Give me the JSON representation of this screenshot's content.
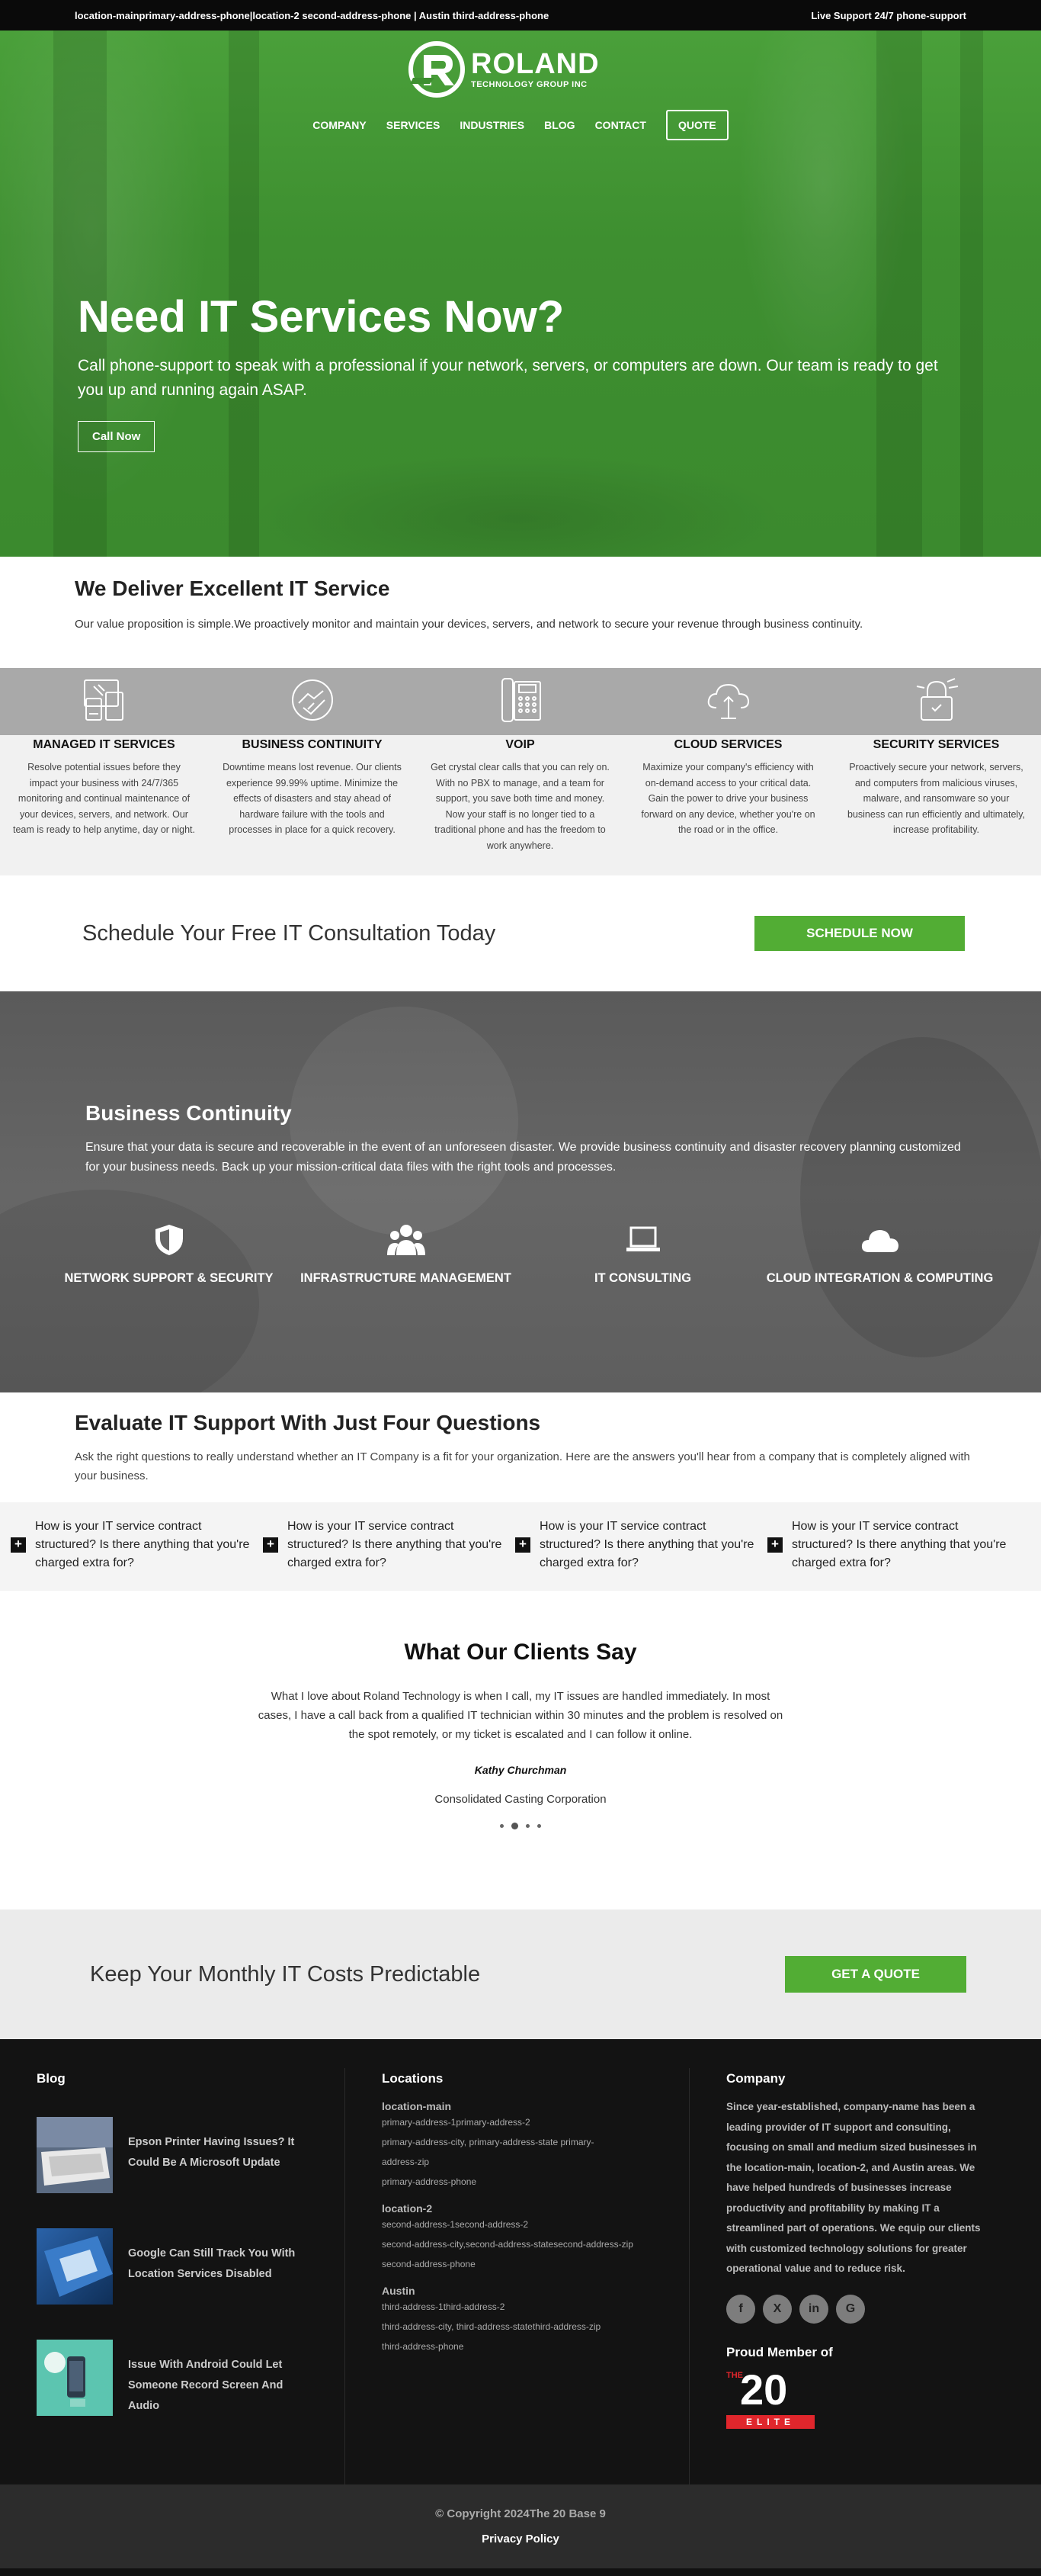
{
  "topbar": {
    "left": "location-mainprimary-address-phone|location-2 second-address-phone | Austin third-address-phone",
    "right": "Live Support 24/7 phone-support"
  },
  "logo": {
    "name": "ROLAND",
    "tagline": "TECHNOLOGY GROUP INC"
  },
  "nav": {
    "items": [
      "COMPANY",
      "SERVICES",
      "INDUSTRIES",
      "BLOG",
      "CONTACT"
    ],
    "quote": "QUOTE"
  },
  "hero": {
    "title": "Need IT Services Now?",
    "text": "Call phone-support to speak with a professional if your network, servers, or computers are down. Our team is ready to get you up and running again ASAP.",
    "button": "Call Now"
  },
  "deliver": {
    "title": "We Deliver Excellent IT Service",
    "text": "Our value proposition is simple.We proactively monitor and maintain your devices, servers, and network to secure your revenue through business continuity."
  },
  "services": [
    {
      "icon": "devices-icon",
      "title": "MANAGED IT SERVICES",
      "text": "Resolve potential issues before they impact your business with 24/7/365 monitoring and continual maintenance of your devices, servers, and network. Our team is ready to help anytime, day or night."
    },
    {
      "icon": "handshake-icon",
      "title": "BUSINESS CONTINUITY",
      "text": "Downtime means lost revenue. Our clients experience 99.99% uptime. Minimize the effects of disasters and stay ahead of hardware failure with the tools and processes in place for a quick recovery."
    },
    {
      "icon": "phone-icon",
      "title": "VOIP",
      "text": "Get crystal clear calls that you can rely on. With no PBX to manage, and a team for support, you save both time and money. Now your staff is no longer tied to a traditional phone and has the freedom to work anywhere."
    },
    {
      "icon": "cloud-icon",
      "title": "CLOUD SERVICES",
      "text": "Maximize your company's efficiency with on-demand access to your critical data. Gain the power to drive your business forward on any device, whether you're on the road or in the office."
    },
    {
      "icon": "security-icon",
      "title": "SECURITY SERVICES",
      "text": "Proactively secure your network, servers, and computers from malicious viruses, malware, and ransomware so your business can run efficiently and ultimately, increase profitability."
    }
  ],
  "schedule": {
    "text": "Schedule Your Free IT Consultation Today",
    "button": "SCHEDULE NOW"
  },
  "continuity": {
    "title": "Business Continuity",
    "text": "Ensure that your data is secure and recoverable in the event of an unforeseen disaster. We provide business continuity and disaster recovery planning customized for your business needs. Back up your mission-critical data files with the right tools and processes.",
    "items": [
      {
        "icon": "shield-icon",
        "label": "NETWORK SUPPORT & SECURITY"
      },
      {
        "icon": "users-icon",
        "label": "INFRASTRUCTURE MANAGEMENT"
      },
      {
        "icon": "laptop-icon",
        "label": "IT CONSULTING"
      },
      {
        "icon": "cloud-icon",
        "label": "CLOUD INTEGRATION & COMPUTING"
      }
    ]
  },
  "evaluate": {
    "title": "Evaluate IT Support With Just Four Questions",
    "text": "Ask the right questions to really understand whether an IT Company is a fit for your organization. Here are the answers you'll hear from a company that is completely aligned with your business.",
    "questions": [
      "How is your IT service contract structured? Is there anything that you're charged extra for?",
      "How is your IT service contract structured? Is there anything that you're charged extra for?",
      "How is your IT service contract structured? Is there anything that you're charged extra for?",
      "How is your IT service contract structured? Is there anything that you're charged extra for?"
    ]
  },
  "testimonials": {
    "title": "What Our Clients Say",
    "quote": "What I love about Roland Technology is when I call, my IT issues are handled immediately. In most cases, I have a call back from a qualified IT technician within 30 minutes and the problem is resolved on the spot remotely, or my ticket is escalated and I can follow it online.",
    "name": "Kathy Churchman",
    "company": "Consolidated Casting Corporation"
  },
  "costs": {
    "text": "Keep Your Monthly IT Costs Predictable",
    "button": "GET A QUOTE"
  },
  "footer": {
    "blog": {
      "title": "Blog",
      "posts": [
        "Epson Printer Having Issues? It Could Be A Microsoft Update",
        "Google Can Still Track You With Location Services Disabled",
        "Issue With Android Could Let Someone Record Screen And Audio"
      ]
    },
    "locations": {
      "title": "Locations",
      "list": [
        {
          "name": "location-main",
          "lines": [
            "primary-address-1primary-address-2",
            "primary-address-city, primary-address-state primary-address-zip",
            "primary-address-phone"
          ]
        },
        {
          "name": "location-2",
          "lines": [
            "second-address-1second-address-2",
            "second-address-city,second-address-statesecond-address-zip",
            "second-address-phone"
          ]
        },
        {
          "name": "Austin",
          "lines": [
            "third-address-1third-address-2",
            "third-address-city, third-address-statethird-address-zip",
            "third-address-phone"
          ]
        }
      ]
    },
    "company": {
      "title": "Company",
      "text": "Since year-established, company-name has been a leading provider of IT support and consulting, focusing on small and medium sized businesses in the location-main, location-2, and Austin areas. We have helped hundreds of businesses increase productivity and profitability by making IT a streamlined part of operations. We equip our clients with customized technology solutions for greater operational value and to reduce risk.",
      "social": [
        "f",
        "X",
        "in",
        "G"
      ],
      "proud": "Proud Member of",
      "badge_the": "THE",
      "badge_num": "20",
      "badge_elite": "ELITE"
    }
  },
  "copyright": {
    "text": "© Copyright 2024The 20 Base 9",
    "privacy": "Privacy Policy"
  }
}
